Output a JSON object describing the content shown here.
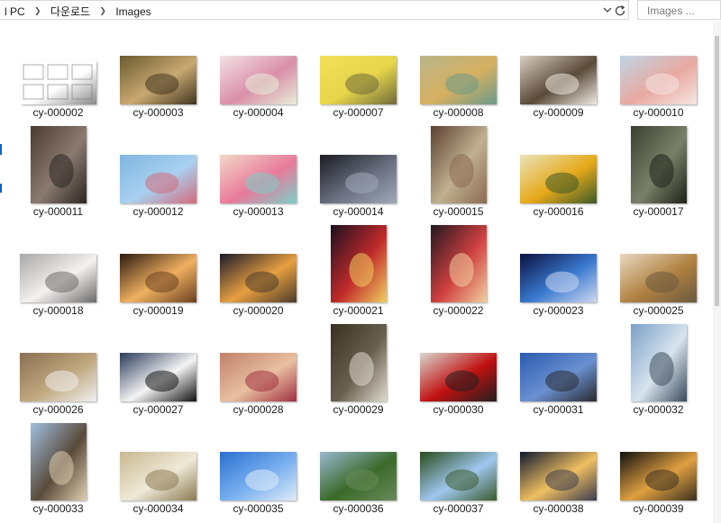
{
  "window": {
    "breadcrumb": {
      "root": "l PC",
      "folder1": "다운로드",
      "folder2": "Images"
    },
    "search_placeholder": "Images ...",
    "icons": {
      "separator": "chevron-right-icon",
      "dropdown": "chevron-down-icon",
      "refresh": "refresh-icon"
    }
  },
  "files": [
    {
      "name": "cy-000002",
      "type": "portrait-doc",
      "colors": [
        "#ffffff",
        "#ffffff",
        "#888888"
      ]
    },
    {
      "name": "cy-000003",
      "type": "landscape",
      "colors": [
        "#6a5a30",
        "#c9a870",
        "#3f3520"
      ]
    },
    {
      "name": "cy-000004",
      "type": "landscape",
      "colors": [
        "#f3e2e6",
        "#d98fa8",
        "#e8eed8"
      ]
    },
    {
      "name": "cy-000007",
      "type": "landscape",
      "colors": [
        "#f1e15a",
        "#e7d54a",
        "#6d6a3a"
      ]
    },
    {
      "name": "cy-000008",
      "type": "landscape",
      "colors": [
        "#b9b58a",
        "#d6b060",
        "#6a9a8a"
      ]
    },
    {
      "name": "cy-000009",
      "type": "landscape",
      "colors": [
        "#d8cfc0",
        "#5a4a3a",
        "#f0ebe2"
      ]
    },
    {
      "name": "cy-000010",
      "type": "landscape",
      "colors": [
        "#bfd5e5",
        "#e8a9a0",
        "#f5e6e3"
      ]
    },
    {
      "name": "cy-000011",
      "type": "portrait",
      "colors": [
        "#4a3a30",
        "#8a7a70",
        "#2a2520"
      ]
    },
    {
      "name": "cy-000012",
      "type": "landscape",
      "colors": [
        "#7fb6e0",
        "#a9d0f0",
        "#d46a7a"
      ]
    },
    {
      "name": "cy-000013",
      "type": "landscape",
      "colors": [
        "#f2d8c8",
        "#e87a9a",
        "#7ad0c8"
      ]
    },
    {
      "name": "cy-000014",
      "type": "landscape",
      "colors": [
        "#1a1c22",
        "#6a7080",
        "#a0a8b8"
      ]
    },
    {
      "name": "cy-000015",
      "type": "portrait",
      "colors": [
        "#5a4030",
        "#c0b090",
        "#8a6a50"
      ]
    },
    {
      "name": "cy-000016",
      "type": "landscape",
      "colors": [
        "#e9e3b8",
        "#e6a818",
        "#3a5a2a"
      ]
    },
    {
      "name": "cy-000017",
      "type": "portrait",
      "colors": [
        "#3a4030",
        "#7a8068",
        "#1c2018"
      ]
    },
    {
      "name": "cy-000018",
      "type": "landscape",
      "colors": [
        "#a8a8a8",
        "#f4f2ef",
        "#6a6a6a"
      ]
    },
    {
      "name": "cy-000019",
      "type": "landscape",
      "colors": [
        "#2a1a10",
        "#f0b060",
        "#6a4020"
      ]
    },
    {
      "name": "cy-000020",
      "type": "landscape",
      "colors": [
        "#1a1a2a",
        "#e8a040",
        "#4a3a2a"
      ]
    },
    {
      "name": "cy-000021",
      "type": "portrait",
      "colors": [
        "#1a1020",
        "#c02a2a",
        "#f0d060"
      ]
    },
    {
      "name": "cy-000022",
      "type": "portrait",
      "colors": [
        "#201820",
        "#d04040",
        "#f0d0a0"
      ]
    },
    {
      "name": "cy-000023",
      "type": "landscape",
      "colors": [
        "#0a1040",
        "#3a7ad0",
        "#d0d8f0"
      ]
    },
    {
      "name": "cy-000025",
      "type": "landscape",
      "colors": [
        "#e8d8c0",
        "#b08040",
        "#6a5a40"
      ]
    },
    {
      "name": "cy-000026",
      "type": "landscape",
      "colors": [
        "#8a7050",
        "#c0a880",
        "#f0f0f0"
      ]
    },
    {
      "name": "cy-000027",
      "type": "landscape",
      "colors": [
        "#2a3a5a",
        "#f4f4f4",
        "#101010"
      ]
    },
    {
      "name": "cy-000028",
      "type": "landscape",
      "colors": [
        "#c0806a",
        "#e8c0a0",
        "#a03040"
      ]
    },
    {
      "name": "cy-000029",
      "type": "portrait",
      "colors": [
        "#3a3020",
        "#6a6050",
        "#e0dcd0"
      ]
    },
    {
      "name": "cy-000030",
      "type": "landscape",
      "colors": [
        "#d8d8d0",
        "#c01010",
        "#202020"
      ]
    },
    {
      "name": "cy-000031",
      "type": "landscape",
      "colors": [
        "#2a5ab0",
        "#6a90d0",
        "#2a2a30"
      ]
    },
    {
      "name": "cy-000032",
      "type": "portrait",
      "colors": [
        "#7aa0c8",
        "#d8e4ee",
        "#3a4a5a"
      ]
    },
    {
      "name": "cy-000033",
      "type": "portrait",
      "colors": [
        "#a0c0e0",
        "#5a4a3a",
        "#e0d0b0"
      ]
    },
    {
      "name": "cy-000034",
      "type": "landscape",
      "colors": [
        "#c8b890",
        "#efe9d8",
        "#8a7a50"
      ]
    },
    {
      "name": "cy-000035",
      "type": "landscape",
      "colors": [
        "#2a70d0",
        "#7ab0f0",
        "#e0ecf8"
      ]
    },
    {
      "name": "cy-000036",
      "type": "landscape",
      "colors": [
        "#9ab8d0",
        "#3a6a2a",
        "#6a8a5a"
      ]
    },
    {
      "name": "cy-000037",
      "type": "landscape",
      "colors": [
        "#2a4a1a",
        "#a0c8f0",
        "#3a5a2a"
      ]
    },
    {
      "name": "cy-000038",
      "type": "landscape",
      "colors": [
        "#101830",
        "#f0c060",
        "#3a3a50"
      ]
    },
    {
      "name": "cy-000039",
      "type": "landscape",
      "colors": [
        "#101010",
        "#e0a040",
        "#3a3020"
      ]
    }
  ]
}
